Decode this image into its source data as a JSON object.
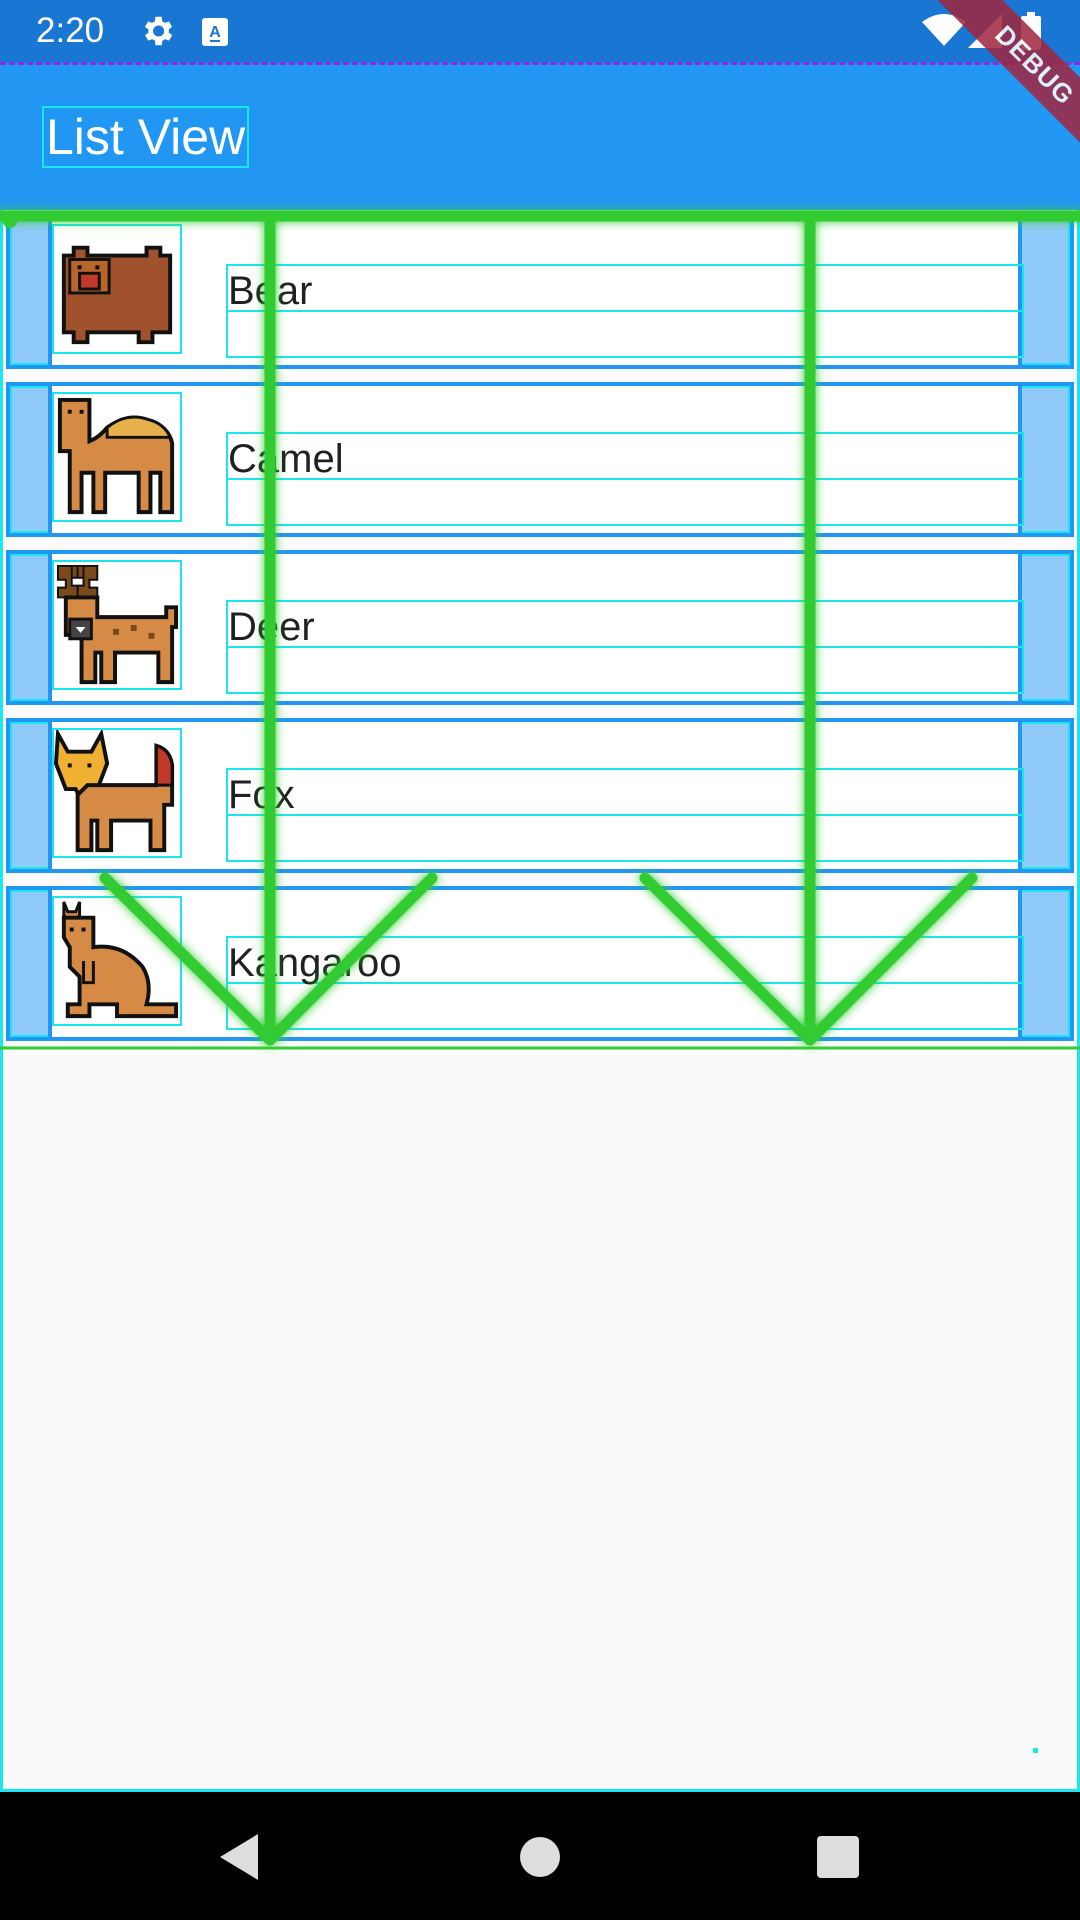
{
  "status_bar": {
    "time": "2:20",
    "icons": [
      "settings-icon",
      "accessibility-icon",
      "wifi-icon",
      "signal-icon",
      "battery-icon"
    ]
  },
  "app_bar": {
    "title": "List View"
  },
  "debug_banner": {
    "text": "DEBUG"
  },
  "list": {
    "items": [
      {
        "label": "Bear",
        "icon": "bear-icon"
      },
      {
        "label": "Camel",
        "icon": "camel-icon"
      },
      {
        "label": "Deer",
        "icon": "deer-icon"
      },
      {
        "label": "Fox",
        "icon": "fox-icon"
      },
      {
        "label": "Kangaroo",
        "icon": "kangaroo-icon"
      }
    ]
  },
  "nav_bar": {
    "buttons": [
      "back-icon",
      "home-icon",
      "recents-icon"
    ]
  },
  "colors": {
    "status_bar": "#1976d2",
    "app_bar": "#2196f3",
    "overscroll_glow": "#33cc33",
    "debug_outline": "#19e6f0"
  }
}
